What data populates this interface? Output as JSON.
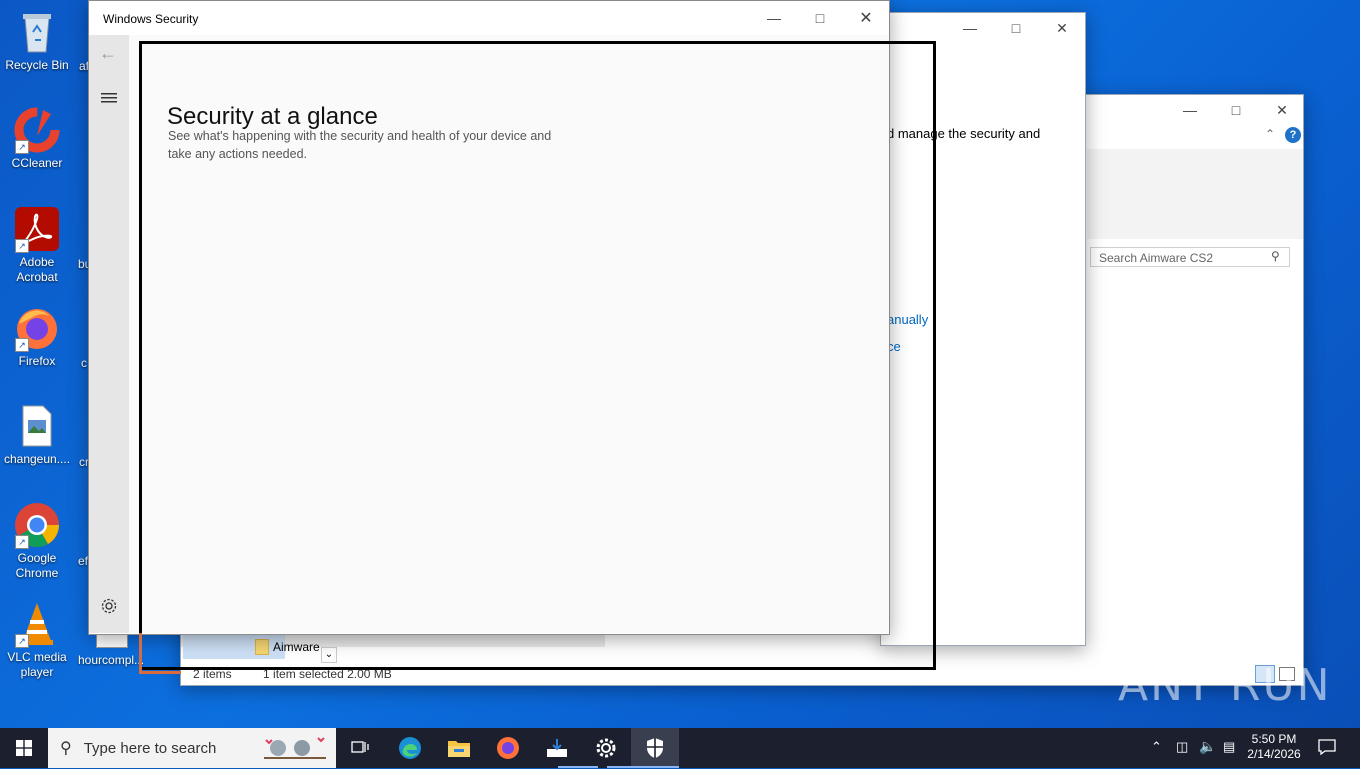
{
  "desktop": {
    "icons": [
      {
        "label": "Recycle Bin"
      },
      {
        "label": "CCleaner"
      },
      {
        "label": "Adobe Acrobat"
      },
      {
        "label": "Firefox"
      },
      {
        "label": "changeun...."
      },
      {
        "label": "Google Chrome"
      },
      {
        "label": "VLC media player"
      }
    ],
    "partial_labels": [
      "af",
      "bu",
      "c",
      "cr",
      "ef",
      "hourcompl..."
    ]
  },
  "settings_window": {
    "text_fragment": "d manage the security and",
    "link1": "anually",
    "link2": "ce"
  },
  "explorer": {
    "search_placeholder": "Search Aimware CS2",
    "folder_label": "Aimware",
    "status_items": "2 items",
    "status_selected": "1 item selected  2.00 MB"
  },
  "security": {
    "title": "Windows Security",
    "heading": "Security at a glance",
    "description": "See what's happening with the security and health of your device and take any actions needed."
  },
  "taskbar": {
    "search_placeholder": "Type here to search",
    "time": "5:50 PM",
    "date": "2/14/2026"
  },
  "watermark": "ANY RUN",
  "colors": {
    "accent": "#0067c0",
    "highlight": "#000000",
    "taskbar": "#1b1f2e"
  }
}
